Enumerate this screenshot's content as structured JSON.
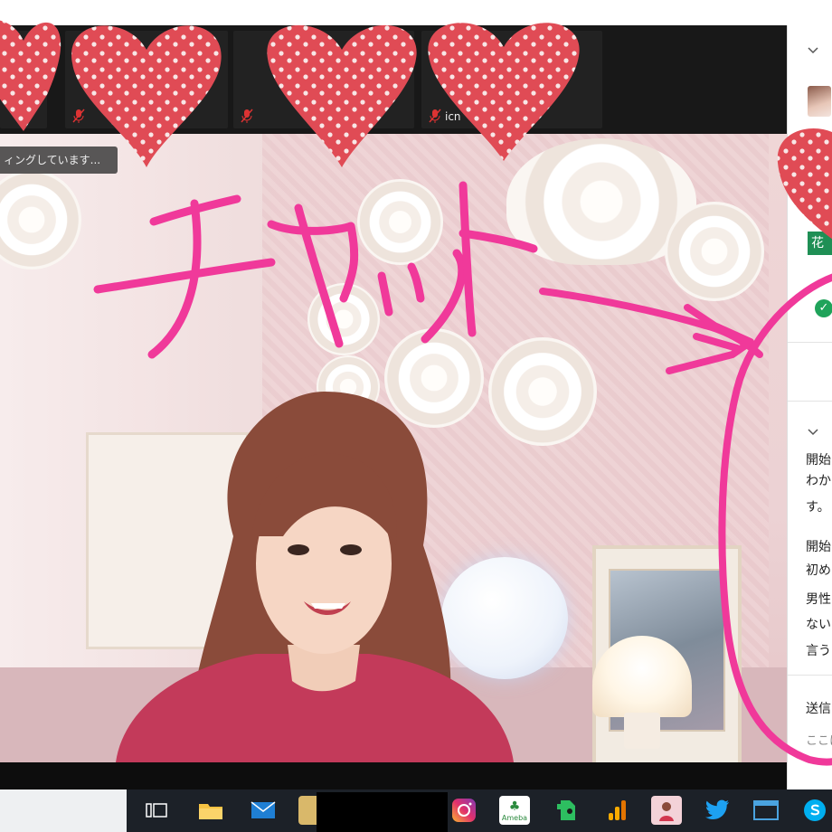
{
  "participants": [
    {
      "name": ""
    },
    {
      "name": ""
    },
    {
      "name": ""
    },
    {
      "name": "icn"
    }
  ],
  "share_notice": "ィングしています...",
  "overlay_text": "チャット",
  "chat_panel": {
    "badge_text": "花",
    "check_symbol": "✓",
    "messages": [
      "開始",
      "わか",
      "す。",
      "開始",
      "初め",
      "男性",
      "ない",
      "言う"
    ],
    "send_to_label": "送信",
    "input_placeholder": "ここに"
  },
  "taskbar": {
    "icons": [
      "task-view",
      "file-explorer",
      "mail",
      "app",
      "instagram",
      "ameba",
      "evernote",
      "analytics",
      "photo",
      "twitter",
      "browser",
      "skype"
    ],
    "ameba_label": "Ameba"
  },
  "colors": {
    "overlay_pink": "#f0399a",
    "heart_red": "#e04b55",
    "heart_dot": "#f8e6e6"
  }
}
